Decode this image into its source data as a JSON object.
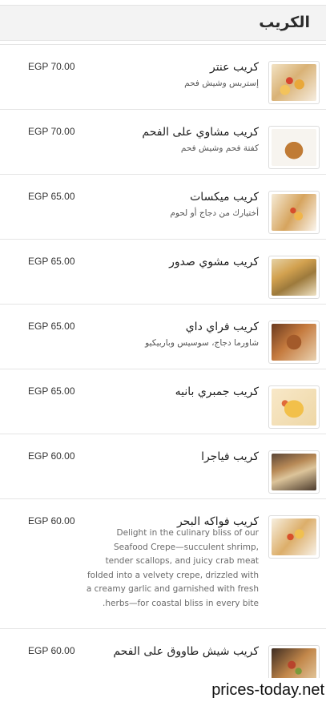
{
  "section": {
    "title": "الكريب"
  },
  "items": [
    {
      "name": "كريب عنتر",
      "desc": "إستربس وشيش فحم",
      "price": "EGP 70.00",
      "image": "crepe-photo"
    },
    {
      "name": "كريب مشاوي على الفحم",
      "desc": "كفتة فحم وشيش فحم",
      "price": "EGP 70.00",
      "image": "crepe-photo"
    },
    {
      "name": "كريب ميكسات",
      "desc": "أختيارك من دجاج أو لحوم",
      "price": "EGP 65.00",
      "image": "crepe-photo"
    },
    {
      "name": "كريب مشوي صدور",
      "desc": "",
      "price": "EGP 65.00",
      "image": "crepe-photo"
    },
    {
      "name": "كريب فراي داي",
      "desc": "شاورما دجاج، سوسيس وباربيكيو",
      "price": "EGP 65.00",
      "image": "crepe-photo"
    },
    {
      "name": "كريب جمبري بانيه",
      "desc": "",
      "price": "EGP 65.00",
      "image": "crepe-photo"
    },
    {
      "name": "كريب فياجرا",
      "desc": "",
      "price": "EGP 60.00",
      "image": "crepe-photo"
    },
    {
      "name": "كريب فواكه البحر",
      "desc": "Delight in the culinary bliss of our Seafood Crepe—succulent shrimp, tender scallops, and juicy crab meat folded into a velvety crepe, drizzled with a creamy garlic and garnished with fresh herbs—for coastal bliss in every bite.",
      "price": "EGP 60.00",
      "image": "crepe-photo"
    },
    {
      "name": "كريب شيش طاووق على الفحم",
      "desc": "",
      "price": "EGP 60.00",
      "image": "crepe-photo"
    }
  ],
  "watermark": "prices-today.net"
}
